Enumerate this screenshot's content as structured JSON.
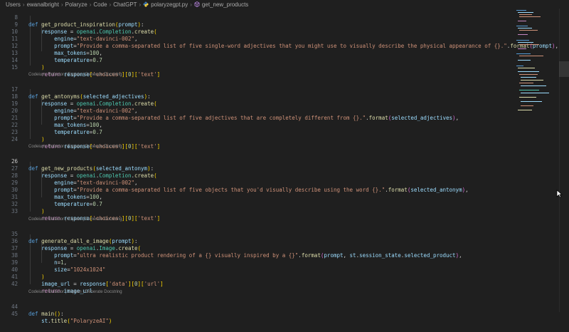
{
  "breadcrumb": {
    "items": [
      "Users",
      "ewanalbright",
      "Polaryze",
      "Code",
      "ChatGPT",
      "polaryzegpt.py",
      "get_new_products"
    ],
    "file_icon": "python-file-icon",
    "symbol_icon": "function-symbol-icon"
  },
  "codelens": {
    "prefix": "Codeium:",
    "refactor": "Refactor",
    "explain": "Explain",
    "docstring": "Generate Docstring",
    "divider": "|"
  },
  "code": {
    "l8": {
      "num": "8",
      "kw": "def",
      "fn": "get_product_inspiration",
      "params": "prompt"
    },
    "l9": {
      "num": "9",
      "var": "response",
      "mod": "openai",
      "cls": "Completion",
      "meth": "create"
    },
    "l10": {
      "num": "10",
      "key": "engine",
      "val": "\"text-davinci-002\""
    },
    "l11": {
      "num": "11",
      "key": "prompt",
      "val": "\"Provide a comma-separated list of five single-word adjectives that you might use to visually describe the physical appearance of {}.\"",
      "fmt": "format",
      "arg": "prompt"
    },
    "l12": {
      "num": "12",
      "key": "max_tokens",
      "val": "100"
    },
    "l13": {
      "num": "13",
      "key": "temperature",
      "val": "0.7"
    },
    "l14": {
      "num": "14"
    },
    "l15": {
      "num": "15",
      "kw": "return",
      "var": "response",
      "k1": "'choices'",
      "idx": "0",
      "k2": "'text'"
    },
    "l17": {
      "num": "17",
      "kw": "def",
      "fn": "get_antonyms",
      "params": "selected_adjectives"
    },
    "l18": {
      "num": "18",
      "var": "response",
      "mod": "openai",
      "cls": "Completion",
      "meth": "create"
    },
    "l19": {
      "num": "19",
      "key": "engine",
      "val": "\"text-davinci-002\""
    },
    "l20": {
      "num": "20",
      "key": "prompt",
      "val": "\"Provide a comma-separated list of five adjectives that are completely different from {}.\"",
      "fmt": "format",
      "arg": "selected_adjectives"
    },
    "l21": {
      "num": "21",
      "key": "max_tokens",
      "val": "100"
    },
    "l22": {
      "num": "22",
      "key": "temperature",
      "val": "0.7"
    },
    "l23": {
      "num": "23"
    },
    "l24": {
      "num": "24",
      "kw": "return",
      "var": "response",
      "k1": "'choices'",
      "idx": "0",
      "k2": "'text'"
    },
    "l26": {
      "num": "26",
      "kw": "def",
      "fn": "get_new_products",
      "params": "selected_antonym"
    },
    "l27": {
      "num": "27",
      "var": "response",
      "mod": "openai",
      "cls": "Completion",
      "meth": "create"
    },
    "l28": {
      "num": "28",
      "key": "engine",
      "val": "\"text-davinci-002\""
    },
    "l29": {
      "num": "29",
      "key": "prompt",
      "val": "\"Provide a comma-separated list of five objects that you'd visually describe using the word {}.\"",
      "fmt": "format",
      "arg": "selected_antonym"
    },
    "l30": {
      "num": "30",
      "key": "max_tokens",
      "val": "100"
    },
    "l31": {
      "num": "31",
      "key": "temperature",
      "val": "0.7"
    },
    "l32": {
      "num": "32"
    },
    "l33": {
      "num": "33",
      "kw": "return",
      "var": "response",
      "k1": "'choices'",
      "idx": "0",
      "k2": "'text'"
    },
    "l35": {
      "num": "35",
      "kw": "def",
      "fn": "generate_dall_e_image",
      "params": "prompt"
    },
    "l36": {
      "num": "36",
      "var": "response",
      "mod": "openai",
      "cls": "Image",
      "meth": "create"
    },
    "l37": {
      "num": "37",
      "key": "prompt",
      "val": "\"ultra realistic product rendering of a {} visually inspired by a {}\"",
      "fmt": "format",
      "arg1": "prompt",
      "obj": "st",
      "attr1": "session_state",
      "attr2": "selected_product"
    },
    "l38": {
      "num": "38",
      "key": "n",
      "val": "1"
    },
    "l39": {
      "num": "39",
      "key": "size",
      "val": "\"1024x1024\""
    },
    "l40": {
      "num": "40"
    },
    "l41": {
      "num": "41",
      "var": "image_url",
      "src": "response",
      "k1": "'data'",
      "idx": "0",
      "k2": "'url'"
    },
    "l42": {
      "num": "42",
      "kw": "return",
      "var": "image_url"
    },
    "l44": {
      "num": "44",
      "kw": "def",
      "fn": "main"
    },
    "l45": {
      "num": "45",
      "obj": "st",
      "meth": "title",
      "val": "\"PolaryzeAI\""
    }
  },
  "colors": {
    "background": "#1f1f1f",
    "keyword": "#569cd6",
    "function": "#dcdcaa",
    "variable": "#9cdcfe",
    "string": "#ce9178",
    "number": "#b5cea8",
    "class": "#4ec9b0"
  }
}
